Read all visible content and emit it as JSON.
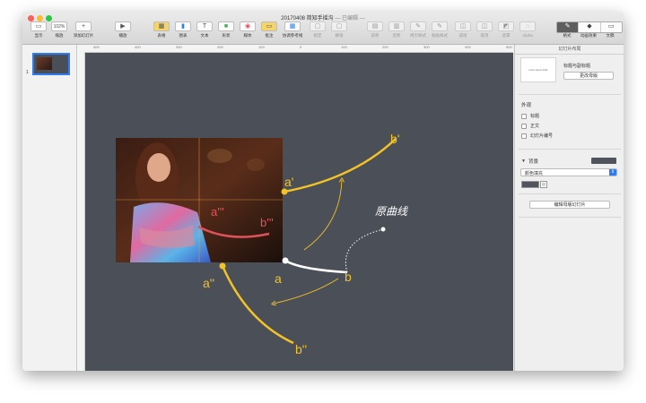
{
  "window": {
    "doc_name": "20170408 简知手摇沟",
    "doc_state": "— 已编辑 —"
  },
  "toolbar": {
    "view": "显示",
    "zoom": "缩放",
    "zoom_value": "102%",
    "add_slide": "添加幻灯片",
    "play": "播放",
    "table": "表格",
    "chart": "图表",
    "text": "文本",
    "shape": "形状",
    "media": "媒体",
    "comment": "批注",
    "collaborate": "协调参考线",
    "lock": "锁定",
    "unlock": "解锁",
    "front": "前移",
    "back": "后移",
    "copy_style": "拷贝样式",
    "paste_style": "粘贴样式",
    "group": "成组",
    "ungroup": "取消",
    "mask": "遮罩",
    "alpha": "Alpha",
    "format": "格式",
    "animate": "动画效果",
    "document": "文稿",
    "icon_play": "▶",
    "icon_table": "▦",
    "icon_chart": "▮",
    "icon_text": "T",
    "icon_shape": "■",
    "icon_media": "◉",
    "icon_comment": "▭",
    "icon_add": "+"
  },
  "navigator": {
    "slide_number": "1"
  },
  "ruler": {
    "top_marks": [
      "500",
      "400",
      "300",
      "200",
      "100",
      "0",
      "100",
      "200",
      "300",
      "400",
      "500"
    ]
  },
  "slide": {
    "labels": {
      "a_prime": "a'",
      "b_prime": "b'",
      "a_triple": "a'''",
      "b_triple": "b'''",
      "a_double": "a''",
      "b_double": "b''",
      "a": "a",
      "b": "b",
      "original_curve": "原曲线"
    },
    "colors": {
      "background": "#4b4f58",
      "yellow": "#f2c227",
      "red": "#e0525a",
      "white": "#ffffff"
    }
  },
  "inspector": {
    "header": "幻灯片布局",
    "master_name": "标题与副标题",
    "master_thumb_text": "Lorem Ipsum Dolor",
    "change_master": "更改母版",
    "appearance": "外观",
    "checks": [
      "标题",
      "正文",
      "幻灯片编号"
    ],
    "background": "背景",
    "fill_type": "颜色填充",
    "edit_master": "编辑母版幻灯片"
  }
}
